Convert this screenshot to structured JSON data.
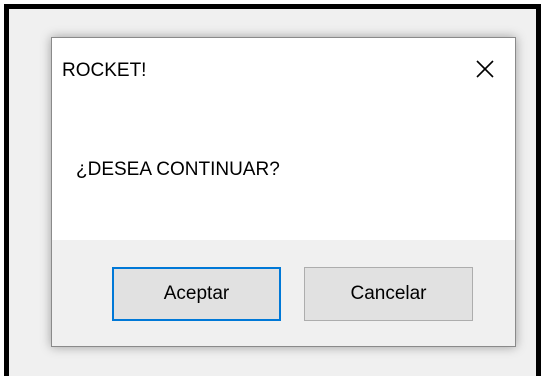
{
  "dialog": {
    "title": "ROCKET!",
    "message": "¿DESEA CONTINUAR?",
    "close_icon": "close-icon"
  },
  "buttons": {
    "ok_label": "Aceptar",
    "cancel_label": "Cancelar"
  },
  "colors": {
    "focus_border": "#0078d7",
    "button_face": "#e1e1e1",
    "footer_bg": "#f0f0f0"
  }
}
